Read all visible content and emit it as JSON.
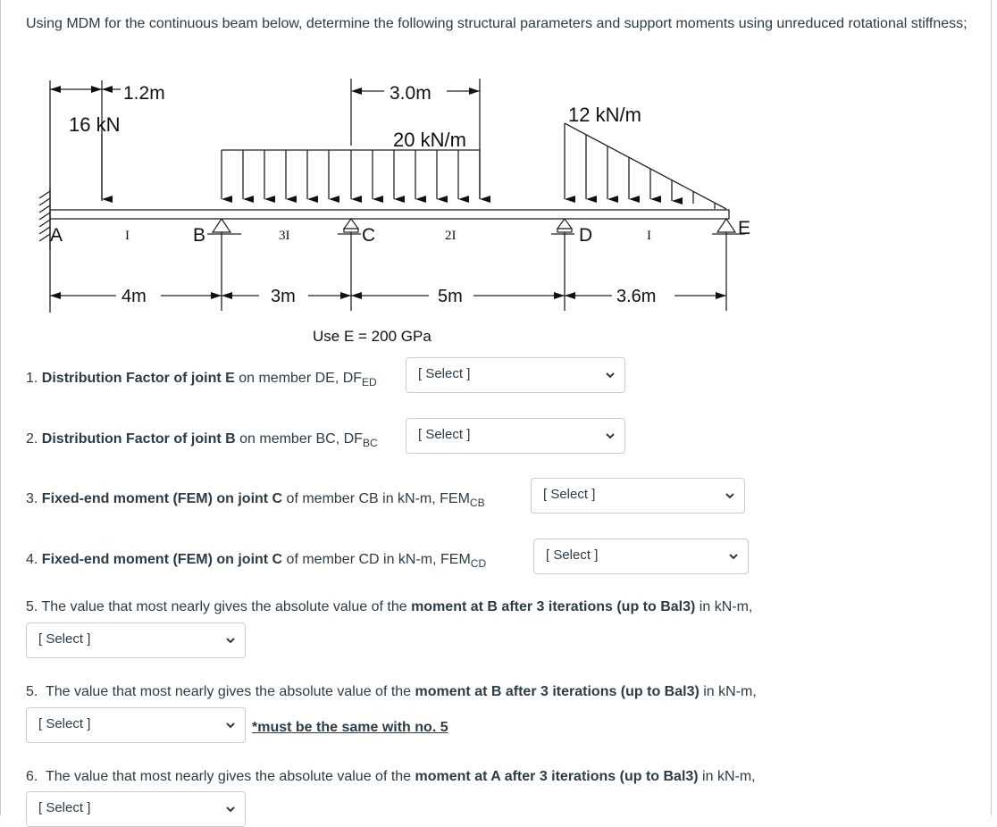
{
  "intro": "Using MDM for the continuous beam below, determine the following structural parameters and support moments using unreduced rotational stiffness;",
  "diagram": {
    "point_load": "16 kN",
    "point_load_dim": "1.2m",
    "udl_label": "20 kN/m",
    "udl_dim": "3.0m",
    "tri_label": "12 kN/m",
    "supports": [
      "A",
      "B",
      "C",
      "D",
      "E"
    ],
    "members": [
      {
        "name": "AB",
        "inertia": "I",
        "span": "4m"
      },
      {
        "name": "BC",
        "inertia": "3I",
        "span": "3m"
      },
      {
        "name": "CD",
        "inertia": "2I",
        "span": "5m"
      },
      {
        "name": "DE",
        "inertia": "I",
        "span": "3.6m"
      }
    ],
    "modulus": "Use E = 200 GPa"
  },
  "questions": [
    {
      "num": "1.",
      "bold": "Distribution Factor of joint E",
      "rest": " on member DE, DF",
      "sub": "ED",
      "select": "[ Select ]"
    },
    {
      "num": "2.",
      "bold": "Distribution Factor of joint B",
      "rest": " on member BC, DF",
      "sub": "BC",
      "select": "[ Select ]"
    },
    {
      "num": "3.",
      "bold": "Fixed-end moment (FEM) on joint C",
      "rest": " of member CB in kN-m, FEM",
      "sub": "CB",
      "select": "[ Select ]"
    },
    {
      "num": "4.",
      "bold": "Fixed-end moment (FEM) on joint C",
      "rest": " of member CD in kN-m, FEM",
      "sub": "CD",
      "select": "[ Select ]"
    },
    {
      "num": "5.",
      "pre": " The value that most nearly gives the absolute value of the ",
      "bold": "moment at B after 3 iterations (up to Bal3)",
      "rest": " in kN-m,",
      "select": "[ Select ]"
    },
    {
      "num": "5.",
      "pre": "  The value that most nearly gives the absolute value of the ",
      "bold": "moment at B after 3 iterations (up to Bal3)",
      "rest": " in kN-m,",
      "select": "[ Select ]",
      "note": "*must be the same with no. 5"
    },
    {
      "num": "6.",
      "pre": "  The value that most nearly gives the absolute value of the ",
      "bold": "moment at A after 3 iterations (up to Bal3)",
      "rest": " in kN-m,",
      "select": "[ Select ]"
    }
  ]
}
